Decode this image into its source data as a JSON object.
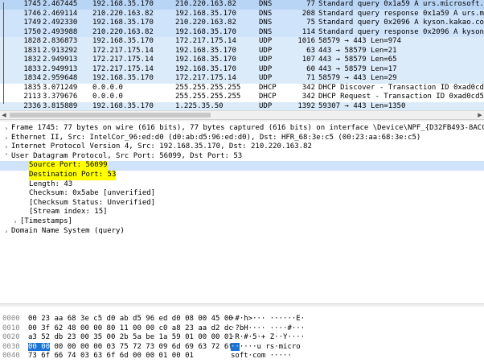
{
  "packets": [
    {
      "no": "1745",
      "time": "2.467445",
      "src": "192.168.35.170",
      "dst": "210.220.163.82",
      "proto": "DNS",
      "len": "77",
      "info": "Standard query 0x1a59 A urs.microsoft.com"
    },
    {
      "no": "1746",
      "time": "2.469114",
      "src": "210.220.163.82",
      "dst": "192.168.35.170",
      "proto": "DNS",
      "len": "208",
      "info": "Standard query response 0x1a59 A urs.micros"
    },
    {
      "no": "1749",
      "time": "2.492330",
      "src": "192.168.35.170",
      "dst": "210.220.163.82",
      "proto": "DNS",
      "len": "75",
      "info": "Standard query 0x2096 A kyson.kakao.com"
    },
    {
      "no": "1750",
      "time": "2.493988",
      "src": "210.220.163.82",
      "dst": "192.168.35.170",
      "proto": "DNS",
      "len": "114",
      "info": "Standard query response 0x2096 A kyson.kaka"
    },
    {
      "no": "1828",
      "time": "2.836873",
      "src": "192.168.35.170",
      "dst": "172.217.175.14",
      "proto": "UDP",
      "len": "1016",
      "info": "58579 → 443 Len=974"
    },
    {
      "no": "1831",
      "time": "2.913292",
      "src": "172.217.175.14",
      "dst": "192.168.35.170",
      "proto": "UDP",
      "len": "63",
      "info": "443 → 58579 Len=21"
    },
    {
      "no": "1832",
      "time": "2.949913",
      "src": "172.217.175.14",
      "dst": "192.168.35.170",
      "proto": "UDP",
      "len": "107",
      "info": "443 → 58579 Len=65"
    },
    {
      "no": "1833",
      "time": "2.949913",
      "src": "172.217.175.14",
      "dst": "192.168.35.170",
      "proto": "UDP",
      "len": "60",
      "info": "443 → 58579 Len=17"
    },
    {
      "no": "1834",
      "time": "2.959648",
      "src": "192.168.35.170",
      "dst": "172.217.175.14",
      "proto": "UDP",
      "len": "71",
      "info": "58579 → 443 Len=29"
    },
    {
      "no": "1835",
      "time": "3.071249",
      "src": "0.0.0.0",
      "dst": "255.255.255.255",
      "proto": "DHCP",
      "len": "342",
      "info": "DHCP Discover - Transaction ID 0xad0cd54e"
    },
    {
      "no": "2113",
      "time": "3.379676",
      "src": "0.0.0.0",
      "dst": "255.255.255.255",
      "proto": "DHCP",
      "len": "342",
      "info": "DHCP Request  - Transaction ID 0xad0cd54e"
    },
    {
      "no": "2336",
      "time": "3.815889",
      "src": "192.168.35.170",
      "dst": "1.225.35.50",
      "proto": "UDP",
      "len": "1392",
      "info": "59307 → 443 Len=1350"
    }
  ],
  "details": [
    {
      "arrow": "›",
      "indent": 0,
      "text": "Frame 1745: 77 bytes on wire (616 bits), 77 bytes captured (616 bits) on interface \\Device\\NPF_{D32FB493-8ACC-4224-A890-"
    },
    {
      "arrow": "›",
      "indent": 0,
      "text": "Ethernet II, Src: IntelCor_96:ed:d0 (d0:ab:d5:96:ed:d0), Dst: HFR_68:3e:c5 (00:23:aa:68:3e:c5)"
    },
    {
      "arrow": "›",
      "indent": 0,
      "text": "Internet Protocol Version 4, Src: 192.168.35.170, Dst: 210.220.163.82"
    },
    {
      "arrow": "˅",
      "indent": 0,
      "text": "User Datagram Protocol, Src Port: 56099, Dst Port: 53"
    },
    {
      "arrow": "",
      "indent": 2,
      "text": "Source Port: 56099",
      "highlight": true,
      "selected": true
    },
    {
      "arrow": "",
      "indent": 2,
      "text": "Destination Port: 53",
      "highlight": true
    },
    {
      "arrow": "",
      "indent": 2,
      "text": "Length: 43"
    },
    {
      "arrow": "",
      "indent": 2,
      "text": "Checksum: 0x5abe [unverified]"
    },
    {
      "arrow": "",
      "indent": 2,
      "text": "[Checksum Status: Unverified]"
    },
    {
      "arrow": "",
      "indent": 2,
      "text": "[Stream index: 15]"
    },
    {
      "arrow": "›",
      "indent": 1,
      "text": "[Timestamps]"
    },
    {
      "arrow": "›",
      "indent": 0,
      "text": "Domain Name System (query)"
    }
  ],
  "bytes": [
    {
      "off": "0000",
      "hex": "00 23 aa 68 3e c5 d0 ab  d5 96 ed d0 08 00 45 00",
      "ascii": "·#·h>··· ······E·"
    },
    {
      "off": "0010",
      "hex": "00 3f 62 48 00 00 80 11  00 00 c0 a8 23 aa d2 dc",
      "ascii": "·?bH···· ····#···"
    },
    {
      "off": "0020",
      "hex": "a3 52 db 23 00 35 00 2b  5a be 1a 59 01 00 00 01",
      "ascii": "·R·#·5·+ Z··Y····"
    },
    {
      "off": "0030",
      "hex_sel": "00 00",
      "hex_rest": " 00 00 00 00 03 75  72 73 09 6d 69 63 72 6f",
      "ascii_sel": "··",
      "ascii_rest": "····u rs·micro"
    },
    {
      "off": "0040",
      "hex": "73 6f 66 74 03 63 6f 6d  00 00 01 00 01",
      "ascii": "soft·com ·····"
    }
  ],
  "colors": {
    "dns_row": "#dcebfa",
    "selected_row": "#b8d5f5",
    "highlight": "#ffff00",
    "byte_select": "#1a73d6"
  },
  "icons": {
    "collapsed": "chevron-right-icon",
    "expanded": "chevron-down-icon"
  }
}
